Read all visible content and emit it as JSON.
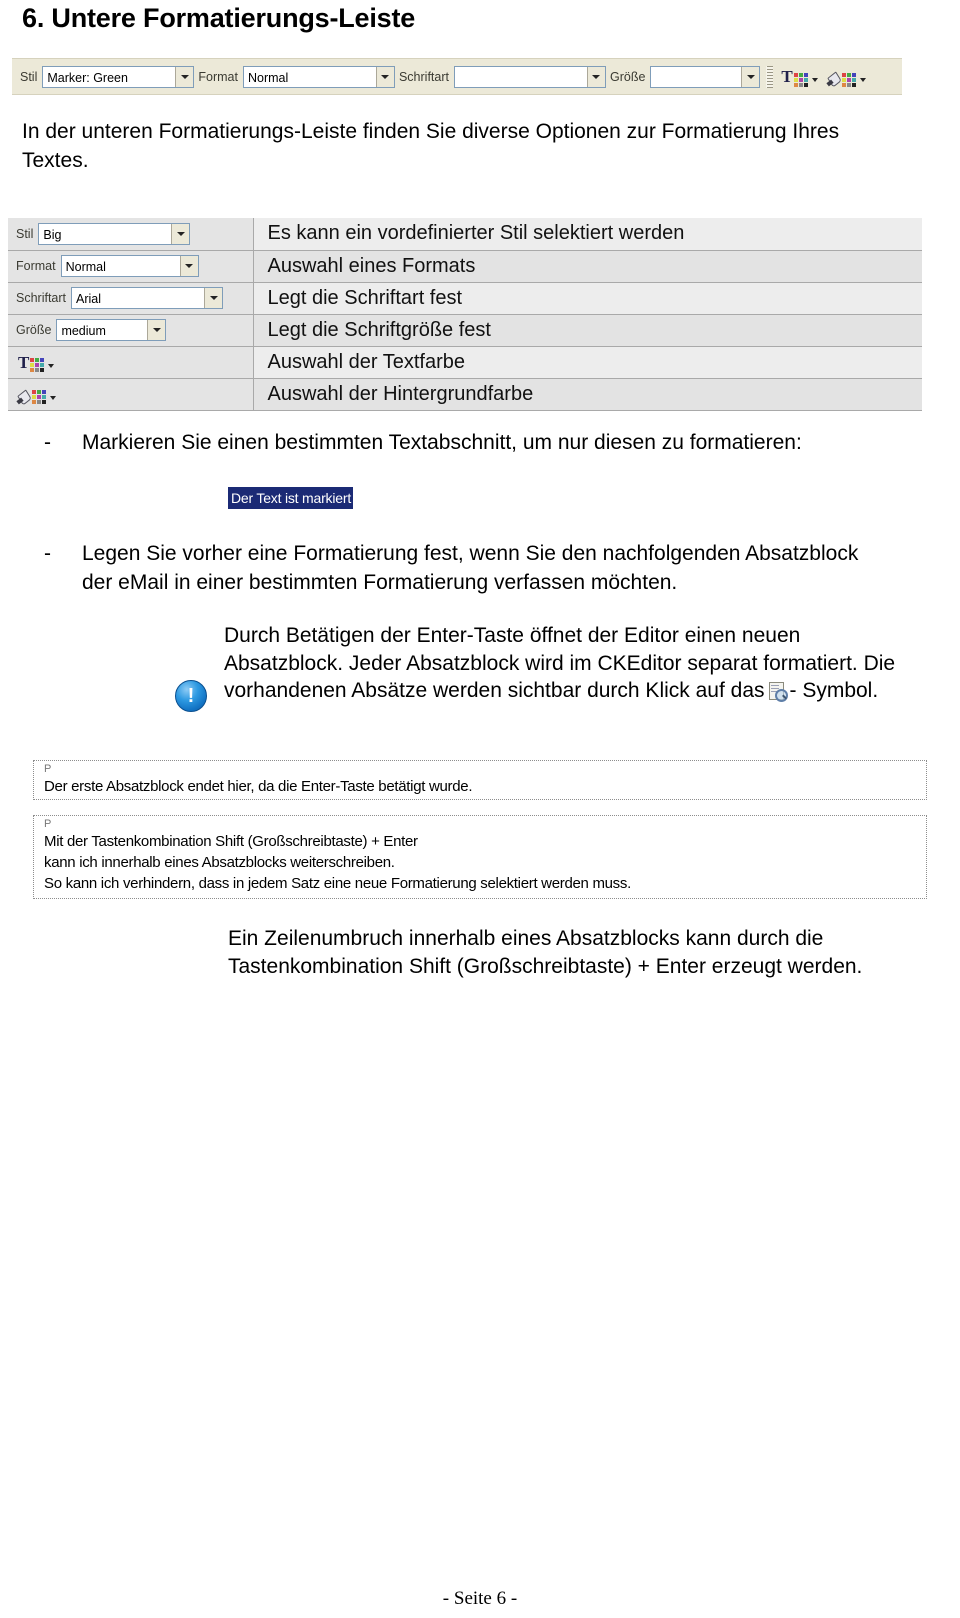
{
  "page": {
    "title": "6. Untere Formatierungs-Leiste",
    "footer": "- Seite 6 -"
  },
  "toolbar_screenshot": {
    "style_label": "Stil",
    "style_value": "Marker: Green",
    "format_label": "Format",
    "format_value": "Normal",
    "font_label": "Schriftart",
    "font_value": "",
    "size_label": "Größe",
    "size_value": "",
    "text_color_icon": "text-color-icon",
    "bg_color_icon": "background-color-icon",
    "background_color": "#ece9d8",
    "border_color": "#7f9db9"
  },
  "intro": "In der unteren Formatierungs-Leiste finden Sie diverse Optionen zur Formatierung Ihres Textes.",
  "description_table": {
    "rows": [
      {
        "control_type": "combo",
        "label": "Stil",
        "value": "Big",
        "description": "Es kann ein vordefinierter Stil selektiert werden"
      },
      {
        "control_type": "combo",
        "label": "Format",
        "value": "Normal",
        "description": "Auswahl eines Formats"
      },
      {
        "control_type": "combo",
        "label": "Schriftart",
        "value": "Arial",
        "description": "Legt die Schriftart fest"
      },
      {
        "control_type": "combo",
        "label": "Größe",
        "value": "medium",
        "description": "Legt die Schriftgröße fest"
      },
      {
        "control_type": "text-color",
        "label": "",
        "value": "",
        "description": "Auswahl der Textfarbe"
      },
      {
        "control_type": "bg-color",
        "label": "",
        "value": "",
        "description": "Auswahl der Hintergrundfarbe"
      }
    ]
  },
  "bullets": {
    "dash": "-",
    "first": "Markieren Sie einen bestimmten Textabschnitt, um nur diesen zu formatieren:",
    "second": "Legen Sie vorher eine Formatierung fest, wenn Sie den nachfolgenden Absatzblock der eMail in einer bestimmten Formatierung verfassen möchten."
  },
  "marked_sample": {
    "text": "Der Text ist markiert",
    "highlight_color": "#1b2a75",
    "text_color": "#ffffff"
  },
  "note": {
    "icon": "info-exclamation-icon",
    "text_before_icon": "Durch Betätigen der Enter-Taste öffnet der Editor einen neuen Absatzblock. Jeder Absatzblock wird im CKEditor separat formatiert. Die vorhandenen Absätze werden sichtbar durch Klick auf das",
    "inline_icon": "show-blocks-icon",
    "text_after_icon": "- Symbol."
  },
  "block_screenshots": [
    {
      "tag": "P",
      "lines": [
        "Der erste Absatzblock endet hier, da die Enter-Taste betätigt wurde."
      ]
    },
    {
      "tag": "P",
      "lines": [
        "Mit der Tastenkombination Shift (Großschreibtaste) + Enter",
        "kann ich innerhalb eines Absatzblocks weiterschreiben.",
        "So kann ich verhindern, dass in jedem Satz eine neue Formatierung selektiert werden muss."
      ]
    }
  ],
  "closing": "Ein Zeilenumbruch innerhalb eines Absatzblocks kann durch die Tastenkombination Shift (Großschreibtaste) + Enter erzeugt werden."
}
